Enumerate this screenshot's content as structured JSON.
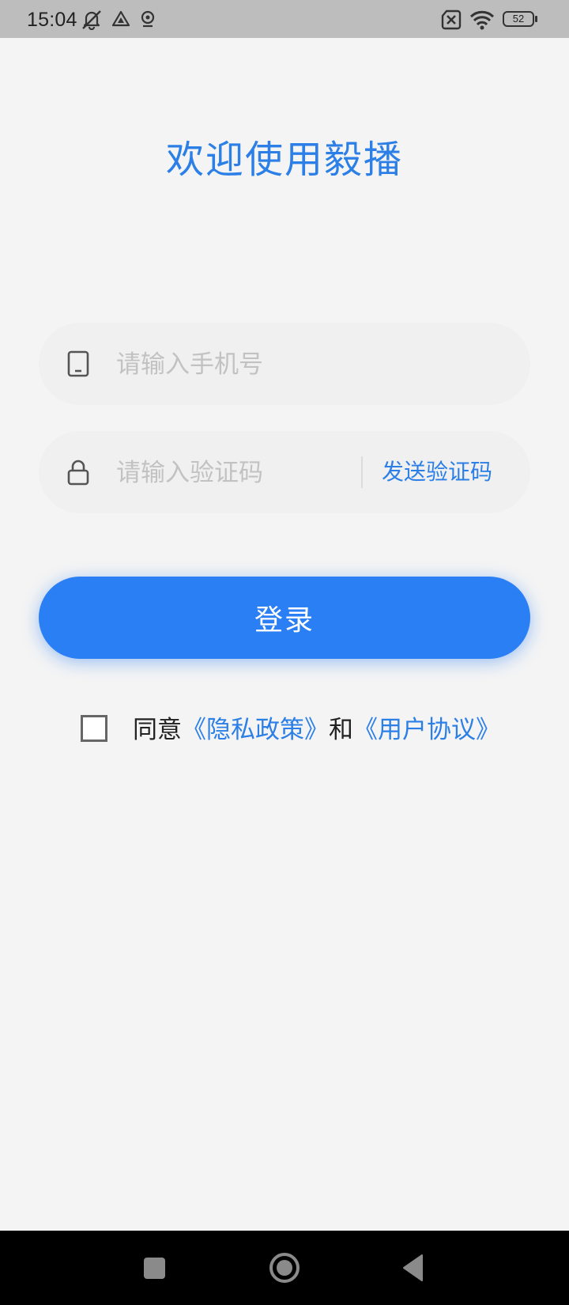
{
  "status_bar": {
    "time": "15:04",
    "battery": "52",
    "icons": [
      "notifications-off-icon",
      "drive-icon",
      "location-icon",
      "no-sim-icon",
      "wifi-icon",
      "battery-icon"
    ]
  },
  "title": "欢迎使用毅播",
  "phone_field": {
    "placeholder": "请输入手机号",
    "value": "",
    "icon": "phone-icon"
  },
  "code_field": {
    "placeholder": "请输入验证码",
    "value": "",
    "icon": "lock-icon",
    "send_label": "发送验证码"
  },
  "login_label": "登录",
  "agreement": {
    "checked": false,
    "prefix": "同意",
    "privacy_link": "《隐私政策》",
    "conjunction": "和",
    "terms_link": "《用户协议》"
  },
  "colors": {
    "accent": "#2b7fe6",
    "button": "#2a7ff5",
    "background": "#f4f4f4",
    "field": "#f0f0f0",
    "status_bar": "#bdbdbd",
    "nav_bar": "#000000"
  },
  "nav_bar": {
    "buttons": [
      "recents-icon",
      "home-icon",
      "back-icon"
    ]
  }
}
